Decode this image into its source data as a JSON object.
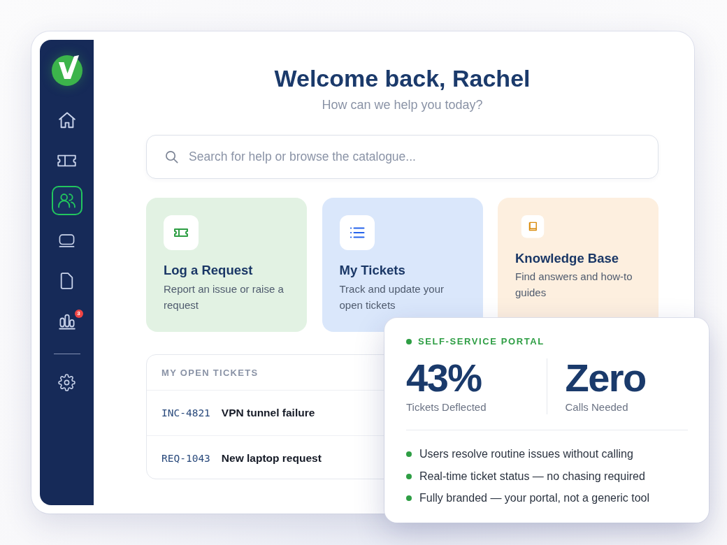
{
  "sidebar": {
    "items": [
      {
        "selected": false
      },
      {
        "selected": false
      },
      {
        "selected": true
      },
      {
        "selected": false
      },
      {
        "selected": false
      },
      {
        "selected": false,
        "badge": "3"
      }
    ],
    "footer_items": [
      {
        "selected": false
      }
    ]
  },
  "header": {
    "title": "Welcome back, Rachel",
    "subtitle": "How can we help you today?"
  },
  "search": {
    "placeholder": "Search for help or browse the catalogue..."
  },
  "cards": [
    {
      "title": "Log a Request",
      "description": "Report an issue or raise a request",
      "color": "#e2f2e3"
    },
    {
      "title": "My Tickets",
      "description": "Track and update your open tickets",
      "color": "#dae7fb"
    },
    {
      "title": "Knowledge Base",
      "description": "Find answers and how-to guides",
      "color": "#fdefdf"
    }
  ],
  "open_tickets": {
    "title": "MY OPEN TICKETS",
    "rows": [
      {
        "id": "INC-4821",
        "summary": "VPN tunnel failure"
      },
      {
        "id": "REQ-1043",
        "summary": "New laptop request"
      }
    ]
  },
  "highlight_card": {
    "label": "SELF-SERVICE PORTAL",
    "stats": [
      {
        "value": "43%",
        "caption": "Tickets Deflected"
      },
      {
        "value": "Zero",
        "caption": "Calls Needed"
      }
    ],
    "points": [
      "Users resolve routine issues without calling",
      "Real-time ticket status — no chasing required",
      "Fully branded — your portal, not a generic tool"
    ]
  }
}
